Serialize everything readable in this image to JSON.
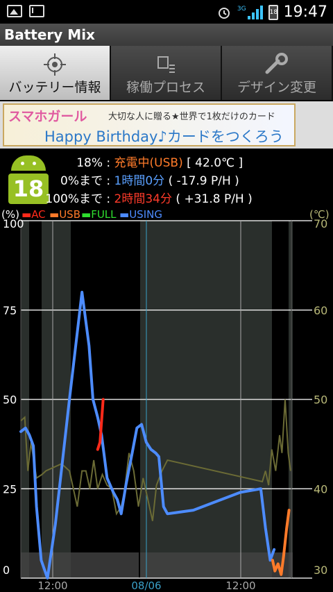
{
  "statusbar": {
    "network": "3G",
    "battery_badge": "18",
    "time": "19:47"
  },
  "app": {
    "title": "Battery Mix"
  },
  "tabs": [
    {
      "label": "バッテリー情報",
      "icon": "crosshair-icon",
      "active": true
    },
    {
      "label": "稼働プロセス",
      "icon": "process-list-icon",
      "active": false
    },
    {
      "label": "デザイン変更",
      "icon": "wrench-icon",
      "active": false
    }
  ],
  "banner": {
    "brand": "スマホガール",
    "tagline": "大切な人に贈る★世界で1枚だけのカード",
    "headline": "Happy Birthday♪カードをつくろう"
  },
  "battery": {
    "level_badge": "18",
    "row1": {
      "key": "18%",
      "sep": " : ",
      "status": "充電中(USB)",
      "temp": " [ 42.0℃ ]"
    },
    "row2": {
      "key": "0%まで",
      "sep": " : ",
      "time": "1時間0分",
      "rate": " ( -17.9 P/H )"
    },
    "row3": {
      "key": "100%まで",
      "sep": " : ",
      "time": "2時間34分",
      "rate": " ( +31.8 P/H )"
    }
  },
  "legend": {
    "unit_left": "(%)",
    "unit_right": "(℃)",
    "items": [
      {
        "label": "AC",
        "color": "#ff2a1a"
      },
      {
        "label": "USB",
        "color": "#ff7b2a"
      },
      {
        "label": "FULL",
        "color": "#2fe02f"
      },
      {
        "label": "USING",
        "color": "#4d8cff"
      }
    ]
  },
  "chart_data": {
    "type": "line",
    "y_left_ticks": [
      "100",
      "75",
      "50",
      "25",
      "0"
    ],
    "y_right_ticks": [
      "70",
      "60",
      "50",
      "40",
      "30"
    ],
    "ylim_left": [
      0,
      100
    ],
    "ylim_right": [
      30,
      70
    ],
    "x_ticks": [
      "12:00",
      "08/06",
      "12:00"
    ],
    "series": [
      {
        "name": "USING",
        "color": "#4d8cff",
        "points": [
          [
            0,
            41
          ],
          [
            0.6,
            42
          ],
          [
            1.1,
            40
          ],
          [
            1.6,
            37
          ],
          [
            2.0,
            20
          ],
          [
            2.6,
            5
          ],
          [
            3.4,
            0
          ],
          [
            4.4,
            15
          ],
          [
            6.2,
            50
          ],
          [
            7.8,
            80
          ],
          [
            8.7,
            65
          ],
          [
            9.2,
            50
          ],
          [
            9.8,
            45
          ],
          [
            10.3,
            40
          ],
          [
            11.0,
            28
          ],
          [
            11.8,
            24
          ],
          [
            12.3,
            22
          ],
          [
            12.8,
            18
          ],
          [
            13.4,
            26
          ],
          [
            14.2,
            35
          ],
          [
            14.8,
            42
          ],
          [
            15.4,
            43
          ],
          [
            16.0,
            38
          ],
          [
            16.6,
            36
          ],
          [
            17.2,
            35
          ],
          [
            17.6,
            34
          ],
          [
            18.2,
            20
          ],
          [
            18.7,
            18
          ],
          [
            22.0,
            19
          ],
          [
            28.0,
            24
          ],
          [
            30.6,
            25
          ],
          [
            31.2,
            14
          ],
          [
            31.8,
            5
          ],
          [
            32.3,
            8
          ]
        ]
      },
      {
        "name": "AC",
        "color": "#ff2a1a",
        "points": [
          [
            9.8,
            36
          ],
          [
            10.1,
            38
          ],
          [
            10.5,
            50
          ]
        ]
      },
      {
        "name": "USB",
        "color": "#ff7b2a",
        "points": [
          [
            32.1,
            5
          ],
          [
            32.4,
            2
          ],
          [
            32.8,
            4
          ],
          [
            33.2,
            1
          ],
          [
            33.5,
            6
          ],
          [
            33.9,
            14
          ],
          [
            34.2,
            19
          ]
        ]
      }
    ]
  }
}
